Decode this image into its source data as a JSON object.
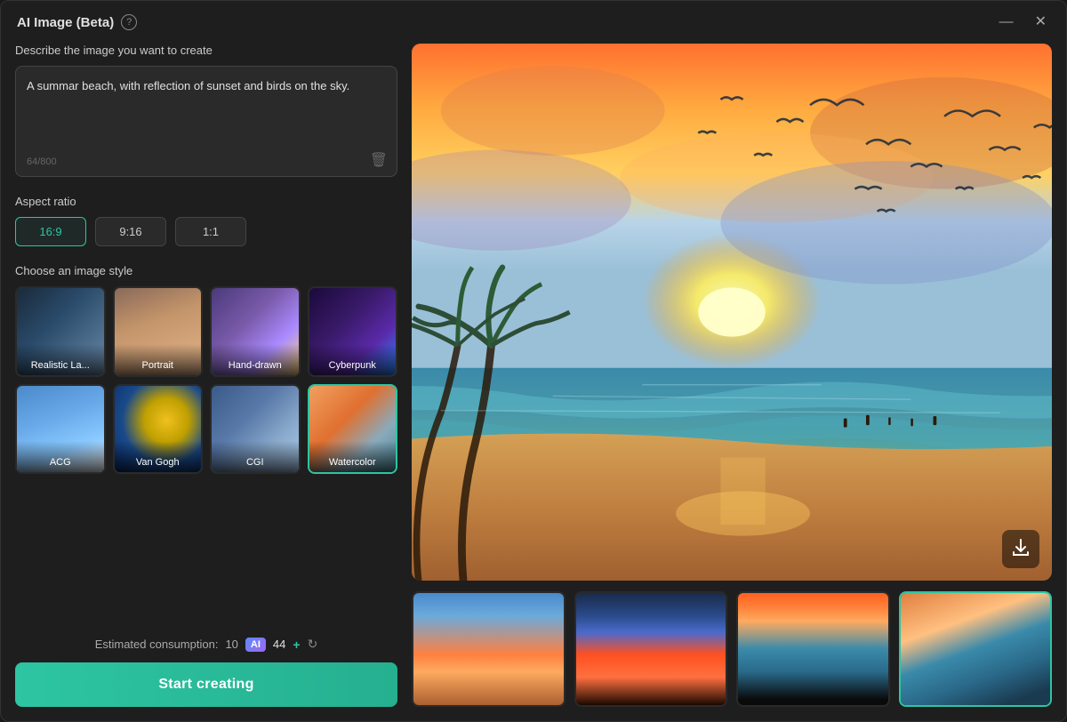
{
  "window": {
    "title": "AI Image (Beta)",
    "minimize_label": "minimize",
    "close_label": "close"
  },
  "left": {
    "prompt_label": "Describe the image you want to create",
    "prompt_value": "A summar beach, with reflection of sunset and birds on the sky.",
    "prompt_counter": "64/800",
    "aspect_label": "Aspect ratio",
    "aspect_options": [
      {
        "label": "16:9",
        "active": true
      },
      {
        "label": "9:16",
        "active": false
      },
      {
        "label": "1:1",
        "active": false
      }
    ],
    "style_label": "Choose an image style",
    "styles": [
      {
        "id": "realistic",
        "label": "Realistic La..."
      },
      {
        "id": "portrait",
        "label": "Portrait"
      },
      {
        "id": "handdrawn",
        "label": "Hand-drawn"
      },
      {
        "id": "cyberpunk",
        "label": "Cyberpunk"
      },
      {
        "id": "acg",
        "label": "ACG"
      },
      {
        "id": "vangogh",
        "label": "Van Gogh"
      },
      {
        "id": "cgi",
        "label": "CGI"
      },
      {
        "id": "watercolor",
        "label": "Watercolor",
        "active": true
      }
    ],
    "estimated_label": "Estimated consumption:",
    "estimated_value": "10",
    "credits": "44",
    "start_btn_label": "Start creating"
  }
}
